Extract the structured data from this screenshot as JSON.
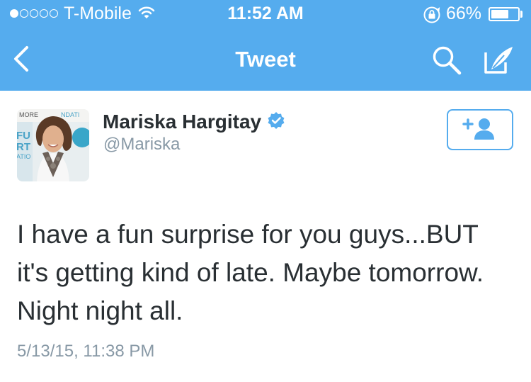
{
  "status_bar": {
    "signal_filled": 1,
    "signal_total": 5,
    "carrier": "T-Mobile",
    "time": "11:52 AM",
    "battery_percent_label": "66%",
    "battery_level": 0.66,
    "icons": [
      "wifi-icon",
      "orientation-lock-icon",
      "battery-icon"
    ]
  },
  "nav_bar": {
    "title": "Tweet",
    "icons": [
      "back-icon",
      "search-icon",
      "compose-icon"
    ]
  },
  "tweet": {
    "author_name": "Mariska Hargitay",
    "author_handle": "@Mariska",
    "verified": true,
    "text": "I have a fun surprise for you guys...BUT it's getting kind of late. Maybe tomorrow. Night night all.",
    "timestamp": "5/13/15, 11:38 PM"
  },
  "colors": {
    "brand_blue": "#55acee",
    "text_dark": "#292f33",
    "text_muted": "#8899a6"
  }
}
